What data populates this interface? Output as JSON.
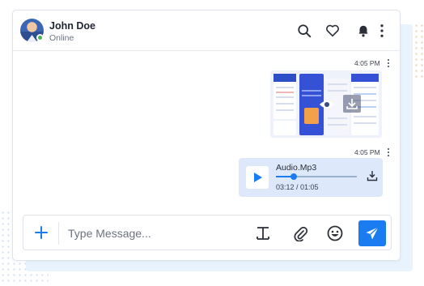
{
  "contact": {
    "name": "John Doe",
    "status": "Online"
  },
  "header_icons": [
    "search-icon",
    "heart-icon",
    "bell-icon",
    "more-vertical-icon"
  ],
  "messages": [
    {
      "type": "image",
      "time": "4:05 PM"
    },
    {
      "type": "audio",
      "time": "4:05 PM",
      "file_name": "Audio.Mp3",
      "elapsed_total": "03:12 / 01:05",
      "progress": 0.22
    }
  ],
  "composer": {
    "placeholder": "Type Message...",
    "icons": [
      "plus-icon",
      "text-format-icon",
      "paperclip-icon",
      "emoji-icon",
      "send-icon"
    ]
  },
  "colors": {
    "accent": "#1b7cf2",
    "online": "#3fb950",
    "audio_bubble": "#dde9fb",
    "backdrop": "#e8f3fd"
  }
}
